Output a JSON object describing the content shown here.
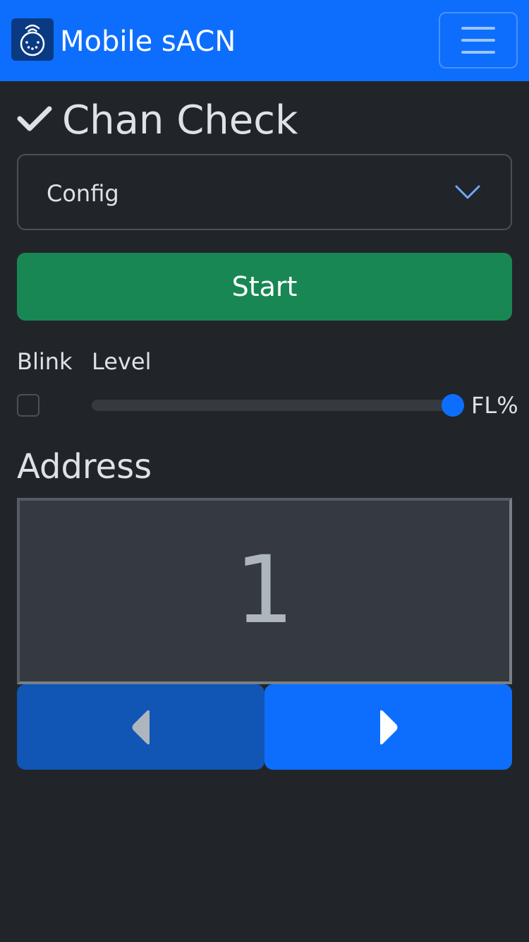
{
  "navbar": {
    "title": "Mobile sACN",
    "logo_icon": "dmx-connector-icon",
    "menu_icon": "hamburger-menu-icon",
    "background": "#0d6efd"
  },
  "page": {
    "heading": "Chan Check",
    "heading_icon": "check-icon"
  },
  "config_select": {
    "value": "Config",
    "icon": "chevron-down-icon"
  },
  "start_button": {
    "label": "Start",
    "color": "#198754"
  },
  "controls": {
    "blink_label": "Blink",
    "level_label": "Level",
    "blink_checked": false,
    "level_fraction": 1.0,
    "level_readout": "FL%"
  },
  "address": {
    "heading": "Address",
    "value": "1"
  },
  "nav_buttons": {
    "prev_icon": "caret-left-icon",
    "next_icon": "caret-right-icon",
    "prev_color": "#1155b5",
    "next_color": "#0d6efd"
  }
}
